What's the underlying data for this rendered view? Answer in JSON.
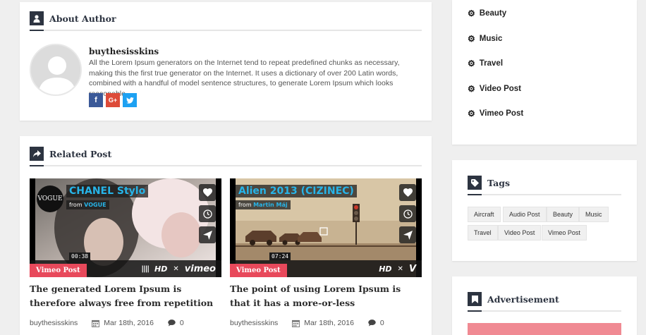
{
  "about_author": {
    "title": "About Author",
    "name": "buythesisskins",
    "bio": "All the Lorem Ipsum generators on the Internet tend to repeat predefined chunks as necessary, making this the first true generator on the Internet. It uses a dictionary of over 200 Latin words, combined with a handful of model sentence structures, to generate Lorem Ipsum which looks reasonable.",
    "social": [
      {
        "label": "f",
        "name": "facebook",
        "color": "#3b5998"
      },
      {
        "label": "G+",
        "name": "google-plus",
        "color": "#dd4b39"
      },
      {
        "label": "t",
        "name": "twitter",
        "color": "#1da1f2"
      }
    ]
  },
  "related": {
    "title": "Related Post",
    "posts": [
      {
        "video_title": "CHANEL Stylo",
        "video_from": "from",
        "video_channel": "VOGUE",
        "logo_text": "VOGUE",
        "duration": "00:38",
        "badge": "Vimeo Post",
        "title": "The generated Lorem Ipsum is therefore always free from repetition",
        "author": "buythesisskins",
        "date": "Mar 18th, 2016",
        "comments": "0"
      },
      {
        "video_title": "Alien 2013 (CIZINEC)",
        "video_from": "from",
        "video_channel": "Martin Máj",
        "duration": "07:24",
        "badge": "Vimeo Post",
        "title": "The point of using Lorem Ipsum is that it has a more-or-less",
        "author": "buythesisskins",
        "date": "Mar 18th, 2016",
        "comments": "0"
      }
    ],
    "player": {
      "hd": "HD",
      "brand": "vimeo",
      "brand_short": "V"
    }
  },
  "sidebar": {
    "categories": [
      "Beauty",
      "Music",
      "Travel",
      "Video Post",
      "Vimeo Post"
    ],
    "tags_title": "Tags",
    "tags": [
      "Aircraft",
      "Audio Post",
      "Beauty",
      "Music",
      "Travel",
      "Video Post",
      "Vimeo Post"
    ],
    "ad_title": "Advertisement"
  },
  "colors": {
    "accent": "#e8495b",
    "dark": "#2d3441",
    "video_title": "#27b4e8"
  }
}
